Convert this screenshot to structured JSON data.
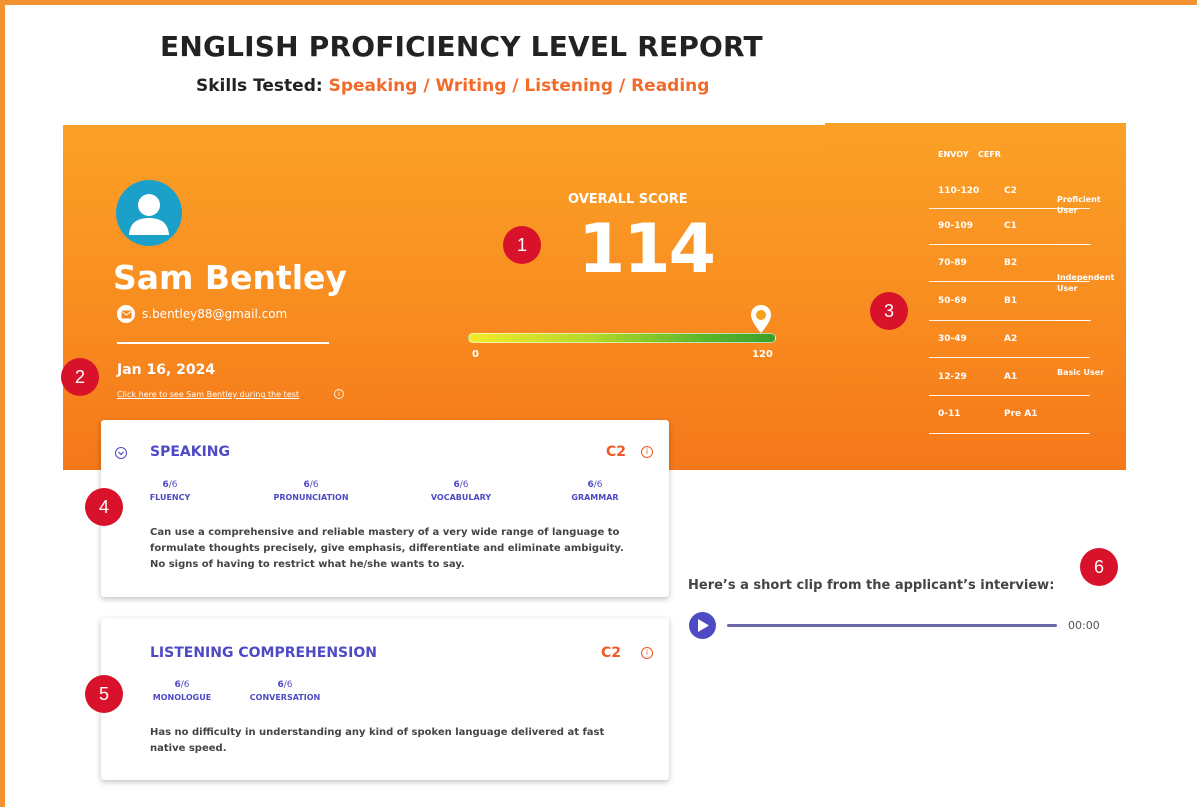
{
  "header": {
    "title": "ENGLISH PROFICIENCY LEVEL REPORT",
    "skills_label": "Skills Tested:",
    "skills_value": "Speaking / Writing / Listening / Reading"
  },
  "candidate": {
    "name": "Sam Bentley",
    "email": "s.bentley88@gmail.com",
    "date": "Jan 16, 2024",
    "video_link": "Click here to see Sam Bentley during the test",
    "info_glyph": "i"
  },
  "score": {
    "label": "OVERALL SCORE",
    "value": "114",
    "min": "0",
    "max": "120",
    "fraction": 0.95
  },
  "cefr_table": {
    "header_envoy": "ENVOY",
    "header_cefr": "CEFR",
    "rows": [
      {
        "envoy": "110-120",
        "cefr": "C2"
      },
      {
        "envoy": "90-109",
        "cefr": "C1"
      },
      {
        "envoy": "70-89",
        "cefr": "B2"
      },
      {
        "envoy": "50-69",
        "cefr": "B1"
      },
      {
        "envoy": "30-49",
        "cefr": "A2"
      },
      {
        "envoy": "12-29",
        "cefr": "A1"
      },
      {
        "envoy": "0-11",
        "cefr": "Pre A1"
      }
    ],
    "groups": [
      "Proficient User",
      "Independent User",
      "Basic User"
    ]
  },
  "speaking": {
    "title": "SPEAKING",
    "level": "C2",
    "subscores": [
      {
        "value": "6",
        "max": "/6",
        "label": "FLUENCY"
      },
      {
        "value": "6",
        "max": "/6",
        "label": "PRONUNCIATION"
      },
      {
        "value": "6",
        "max": "/6",
        "label": "VOCABULARY"
      },
      {
        "value": "6",
        "max": "/6",
        "label": "GRAMMAR"
      }
    ],
    "description": "Can use a comprehensive and reliable mastery of a very wide range of language to formulate thoughts precisely, give emphasis, differentiate and eliminate ambiguity. No signs of having to restrict what he/she wants to say."
  },
  "listening": {
    "title": "LISTENING COMPREHENSION",
    "level": "C2",
    "subscores": [
      {
        "value": "6",
        "max": "/6",
        "label": "MONOLOGUE"
      },
      {
        "value": "6",
        "max": "/6",
        "label": "CONVERSATION"
      }
    ],
    "description": "Has no difficulty in understanding any kind of spoken language delivered at fast native speed."
  },
  "clip": {
    "label": "Here’s a short clip from the applicant’s interview:",
    "time": "00:00"
  },
  "badges": [
    "1",
    "2",
    "3",
    "4",
    "5",
    "6"
  ],
  "colors": {
    "accent_orange": "#f39230",
    "brand_purple": "#4e4ac4",
    "level_orange": "#f05a24",
    "badge_red": "#d9122b",
    "avatar_blue": "#1aa0c9"
  }
}
